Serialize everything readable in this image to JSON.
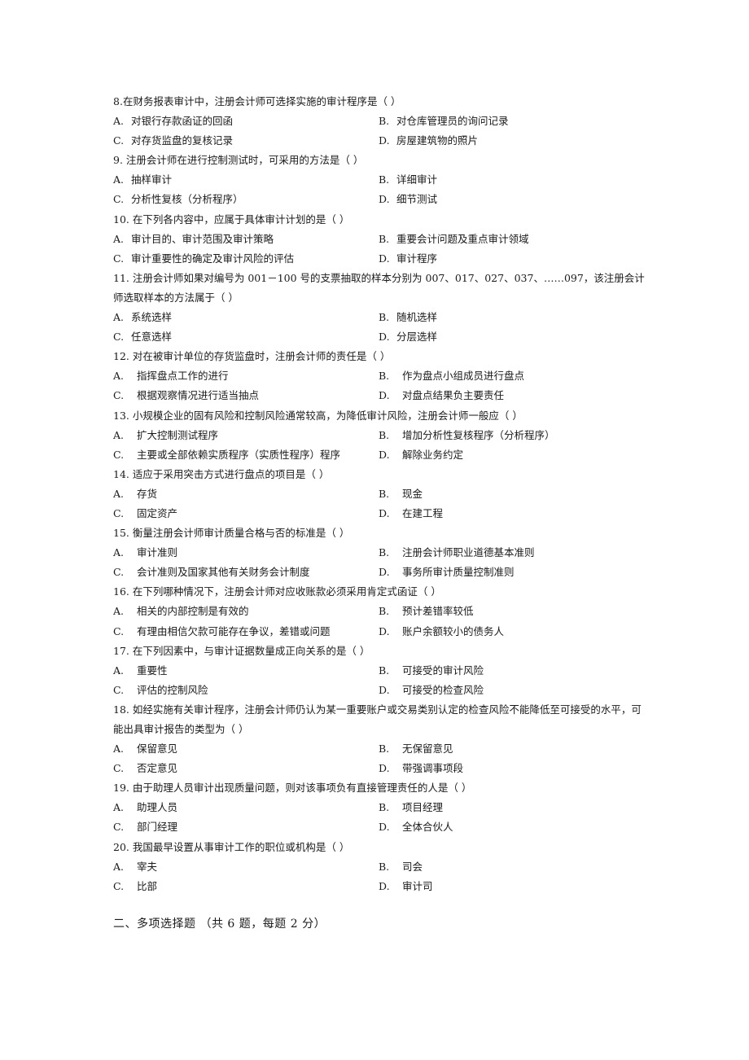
{
  "questions": [
    {
      "number": "8.",
      "text": "在财务报表审计中，注册会计师可选择实施的审计程序是（ ）",
      "options": [
        {
          "label": "A.",
          "text": "对银行存款函证的回函"
        },
        {
          "label": "B.",
          "text": "对仓库管理员的询问记录"
        },
        {
          "label": "C.",
          "text": "对存货监盘的复核记录"
        },
        {
          "label": "D.",
          "text": "房屋建筑物的照片"
        }
      ]
    },
    {
      "number": "9.",
      "text": "注册会计师在进行控制测试时，可采用的方法是（ ）",
      "options": [
        {
          "label": "A.",
          "text": "抽样审计"
        },
        {
          "label": "B.",
          "text": "详细审计"
        },
        {
          "label": "C.",
          "text": "分析性复核（分析程序）"
        },
        {
          "label": "D.",
          "text": "细节测试"
        }
      ]
    },
    {
      "number": "10.",
      "text": "在下列各内容中，应属于具体审计计划的是（ ）",
      "options": [
        {
          "label": "A.",
          "text": "审计目的、审计范围及审计策略"
        },
        {
          "label": "B.",
          "text": "重要会计问题及重点审计领域"
        },
        {
          "label": "C.",
          "text": "审计重要性的确定及审计风险的评估"
        },
        {
          "label": "D.",
          "text": "审计程序"
        }
      ]
    },
    {
      "number": "11.",
      "text": "注册会计师如果对编号为 001－100 号的支票抽取的样本分别为 007、017、027、037、……097，该注册会计师选取样本的方法属于（ ）",
      "options": [
        {
          "label": "A.",
          "text": "系统选样"
        },
        {
          "label": "B.",
          "text": "随机选样"
        },
        {
          "label": "C.",
          "text": "任意选样"
        },
        {
          "label": "D.",
          "text": "分层选样"
        }
      ]
    },
    {
      "number": "12.",
      "text": "对在被审计单位的存货监盘时，注册会计师的责任是（ ）",
      "options": [
        {
          "label": "A.",
          "text": "指挥盘点工作的进行"
        },
        {
          "label": "B.",
          "text": "作为盘点小组成员进行盘点"
        },
        {
          "label": "C.",
          "text": "根据观察情况进行适当抽点"
        },
        {
          "label": "D.",
          "text": "对盘点结果负主要责任"
        }
      ]
    },
    {
      "number": "13.",
      "text": "小规模企业的固有风险和控制风险通常较高，为降低审计风险，注册会计师一般应（ ）",
      "options": [
        {
          "label": "A.",
          "text": "扩大控制测试程序"
        },
        {
          "label": "B.",
          "text": "增加分析性复核程序（分析程序）"
        },
        {
          "label": "C.",
          "text": "主要或全部依赖实质程序（实质性程序）程序"
        },
        {
          "label": "D.",
          "text": "解除业务约定"
        }
      ]
    },
    {
      "number": "14.",
      "text": "适应于采用突击方式进行盘点的项目是（ ）",
      "options": [
        {
          "label": "A.",
          "text": "存货"
        },
        {
          "label": "B.",
          "text": "现金"
        },
        {
          "label": "C.",
          "text": "固定资产"
        },
        {
          "label": "D.",
          "text": "在建工程"
        }
      ]
    },
    {
      "number": "15.",
      "text": "衡量注册会计师审计质量合格与否的标准是（ ）",
      "options": [
        {
          "label": "A.",
          "text": "审计准则"
        },
        {
          "label": "B.",
          "text": "注册会计师职业道德基本准则"
        },
        {
          "label": "C.",
          "text": "会计准则及国家其他有关财务会计制度"
        },
        {
          "label": "D.",
          "text": "事务所审计质量控制准则"
        }
      ]
    },
    {
      "number": "16.",
      "text": "在下列哪种情况下，注册会计师对应收账款必须采用肯定式函证（ ）",
      "options": [
        {
          "label": "A.",
          "text": "相关的内部控制是有效的"
        },
        {
          "label": "B.",
          "text": "预计差错率较低"
        },
        {
          "label": "C.",
          "text": "有理由相信欠款可能存在争议，差错或问题"
        },
        {
          "label": "D.",
          "text": "账户余额较小的债务人"
        }
      ]
    },
    {
      "number": "17.",
      "text": "在下列因素中，与审计证据数量成正向关系的是（ ）",
      "options": [
        {
          "label": "A.",
          "text": "重要性"
        },
        {
          "label": "B.",
          "text": "可接受的审计风险"
        },
        {
          "label": "C.",
          "text": "评估的控制风险"
        },
        {
          "label": "D.",
          "text": "可接受的检查风险"
        }
      ]
    },
    {
      "number": "18.",
      "text": "如经实施有关审计程序，注册会计师仍认为某一重要账户或交易类别认定的检查风险不能降低至可接受的水平，可能出具审计报告的类型为（ ）",
      "options": [
        {
          "label": "A.",
          "text": "保留意见"
        },
        {
          "label": "B.",
          "text": "无保留意见"
        },
        {
          "label": "C.",
          "text": "否定意见"
        },
        {
          "label": "D.",
          "text": "带强调事项段"
        }
      ]
    },
    {
      "number": "19.",
      "text": "由于助理人员审计出现质量问题，则对该事项负有直接管理责任的人是（ ）",
      "options": [
        {
          "label": "A.",
          "text": "助理人员"
        },
        {
          "label": "B.",
          "text": "项目经理"
        },
        {
          "label": "C.",
          "text": "部门经理"
        },
        {
          "label": "D.",
          "text": "全体合伙人"
        }
      ]
    },
    {
      "number": "20.",
      "text": "我国最早设置从事审计工作的职位或机构是（ ）",
      "options": [
        {
          "label": "A.",
          "text": "宰夫"
        },
        {
          "label": "B.",
          "text": "司会"
        },
        {
          "label": "C.",
          "text": "比部"
        },
        {
          "label": "D.",
          "text": "审计司"
        }
      ]
    }
  ],
  "section_heading": "二、多项选择题  （共 6 题，每题 2 分）"
}
